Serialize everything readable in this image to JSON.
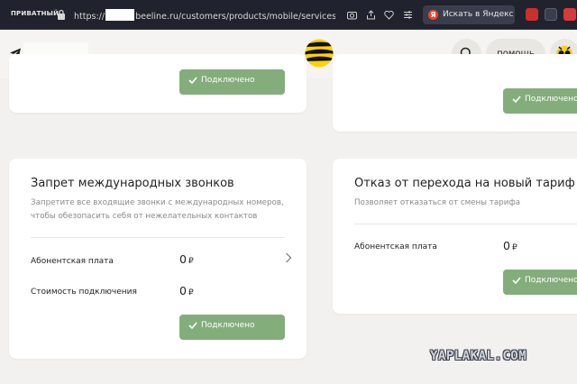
{
  "browser": {
    "private_label": "ПРИВАТНЫЙ",
    "url_prefix": "https://",
    "url_suffix": "beeline.ru/customers/products/mobile/services/cellphone",
    "yandex_search_label": "Искать в Яндекс"
  },
  "header": {
    "help_label": "помощь"
  },
  "cards": {
    "top_left": {
      "button_label": "Подключено"
    },
    "top_right": {
      "button_label": "Подключено"
    },
    "intl_ban": {
      "title": "Запрет международных звонков",
      "desc_line1": "Запретите все входящие звонки с международных номеров,",
      "desc_line2": "чтобы обезопасить себя от нежелательных контактов",
      "fee_label": "Абонентская плата",
      "fee_value": "0",
      "connect_cost_label": "Стоимость подключения",
      "connect_cost_value": "0",
      "currency": "₽",
      "button_label": "Подключено"
    },
    "tariff_refusal": {
      "title": "Отказ от перехода на новый тариф",
      "desc": "Позволяет отказаться от смены тарифа",
      "fee_label": "Абонентская плата",
      "fee_value": "0",
      "currency": "₽",
      "button_label": "Подключено"
    }
  },
  "watermark": "YAPLAKAL.COM"
}
